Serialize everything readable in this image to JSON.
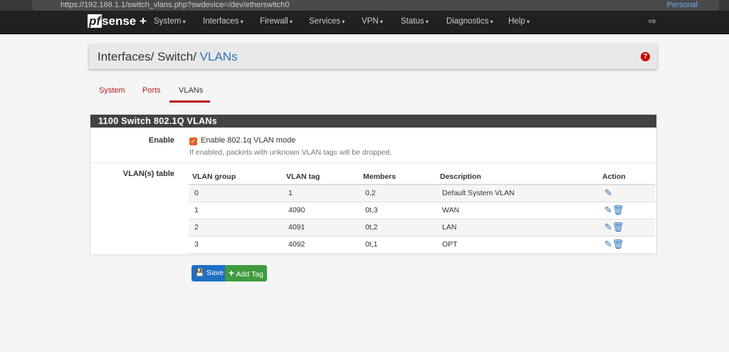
{
  "browser": {
    "url": "https://192.168.1.1/switch_vlans.php?swdevice=/dev/etherswitch0",
    "profile": "Personal"
  },
  "nav": {
    "logo": "sense",
    "logo_prefix": "pf",
    "logo_plus": "+",
    "items": [
      "System",
      "Interfaces",
      "Firewall",
      "Services",
      "VPN",
      "Status",
      "Diagnostics",
      "Help"
    ]
  },
  "breadcrumb": {
    "a": "Interfaces",
    "b": "Switch",
    "c": "VLANs",
    "sep": "/"
  },
  "help_icon": "?",
  "tabs": [
    "System",
    "Ports",
    "VLANs"
  ],
  "active_tab": "VLANs",
  "panel": {
    "title": "1100 Switch 802.1Q VLANs",
    "enable_label": "Enable",
    "enable_checkbox": "Enable 802.1q VLAN mode",
    "enable_checked": true,
    "enable_help": "If enabled, packets with unknown VLAN tags will be dropped.",
    "table_label": "VLAN(s) table",
    "columns": [
      "VLAN group",
      "VLAN tag",
      "Members",
      "Description",
      "Action"
    ],
    "rows": [
      [
        "0",
        "1",
        "0,2",
        "Default System VLAN"
      ],
      [
        "1",
        "4090",
        "0t,3",
        "WAN"
      ],
      [
        "2",
        "4091",
        "0t,2",
        "LAN"
      ],
      [
        "3",
        "4092",
        "0t,1",
        "OPT"
      ]
    ]
  },
  "buttons": {
    "save": "Save",
    "add": "Add Tag"
  },
  "colors": {
    "accent": "#b71c1c",
    "link": "#2e73b8",
    "save": "#1e6fc4",
    "add": "#3e9b3e"
  }
}
